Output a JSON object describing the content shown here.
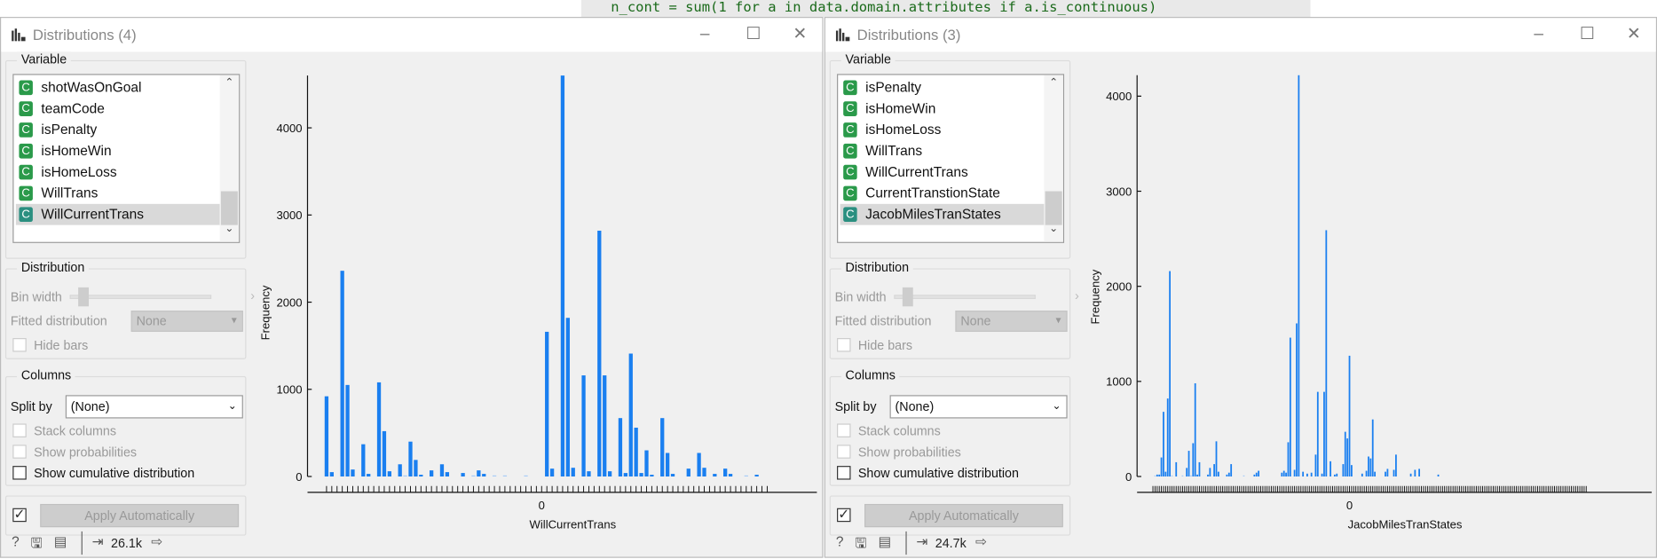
{
  "background_code": "n_cont = sum(1 for a in data.domain.attributes if a.is_continuous)",
  "windows": [
    {
      "title": "Distributions (4)",
      "variable_label": "Variable",
      "variables": [
        "shotWasOnGoal",
        "teamCode",
        "isPenalty",
        "isHomeWin",
        "isHomeLoss",
        "WillTrans",
        "WillCurrentTrans"
      ],
      "selected_index": 6,
      "var_type_badge": "C",
      "distribution_label": "Distribution",
      "bin_width_label": "Bin width",
      "fitted_label": "Fitted distribution",
      "fitted_value": "None",
      "hide_bars_label": "Hide bars",
      "columns_label": "Columns",
      "split_by_label": "Split by",
      "split_by_value": "(None)",
      "stack_label": "Stack columns",
      "prob_label": "Show probabilities",
      "cumulative_label": "Show cumulative distribution",
      "apply_label": "Apply Automatically",
      "apply_checked": true,
      "data_count": "26.1k"
    },
    {
      "title": "Distributions (3)",
      "variable_label": "Variable",
      "variables": [
        "isPenalty",
        "isHomeWin",
        "isHomeLoss",
        "WillTrans",
        "WillCurrentTrans",
        "CurrentTranstionState",
        "JacobMilesTranStates"
      ],
      "selected_index": 6,
      "var_type_badge": "C",
      "distribution_label": "Distribution",
      "bin_width_label": "Bin width",
      "fitted_label": "Fitted distribution",
      "fitted_value": "None",
      "hide_bars_label": "Hide bars",
      "columns_label": "Columns",
      "split_by_label": "Split by",
      "split_by_value": "(None)",
      "stack_label": "Stack columns",
      "prob_label": "Show probabilities",
      "cumulative_label": "Show cumulative distribution",
      "apply_label": "Apply Automatically",
      "apply_checked": true,
      "data_count": "24.7k"
    }
  ],
  "chart_data": [
    {
      "type": "bar",
      "title": "",
      "xlabel": "WillCurrentTrans",
      "ylabel": "Frequency",
      "ylim": [
        0,
        4600
      ],
      "yticks": [
        0,
        1000,
        2000,
        3000,
        4000
      ],
      "bin_count": 85,
      "xticks": [
        {
          "bin": 41,
          "label": "0"
        }
      ],
      "color": "#1a7ff0",
      "bins": [
        [
          0,
          920
        ],
        [
          1,
          50
        ],
        [
          3,
          2360
        ],
        [
          4,
          1050
        ],
        [
          5,
          80
        ],
        [
          7,
          370
        ],
        [
          8,
          30
        ],
        [
          10,
          1080
        ],
        [
          11,
          520
        ],
        [
          12,
          60
        ],
        [
          14,
          140
        ],
        [
          15,
          10
        ],
        [
          16,
          400
        ],
        [
          17,
          190
        ],
        [
          18,
          20
        ],
        [
          20,
          70
        ],
        [
          22,
          140
        ],
        [
          23,
          50
        ],
        [
          26,
          40
        ],
        [
          28,
          10
        ],
        [
          29,
          70
        ],
        [
          30,
          30
        ],
        [
          32,
          10
        ],
        [
          34,
          10
        ],
        [
          38,
          5
        ],
        [
          42,
          1660
        ],
        [
          43,
          90
        ],
        [
          45,
          4600
        ],
        [
          46,
          1820
        ],
        [
          47,
          100
        ],
        [
          49,
          1160
        ],
        [
          50,
          60
        ],
        [
          52,
          2820
        ],
        [
          53,
          1160
        ],
        [
          54,
          60
        ],
        [
          56,
          670
        ],
        [
          57,
          40
        ],
        [
          58,
          1410
        ],
        [
          59,
          560
        ],
        [
          60,
          40
        ],
        [
          61,
          300
        ],
        [
          62,
          20
        ],
        [
          64,
          670
        ],
        [
          65,
          270
        ],
        [
          66,
          30
        ],
        [
          69,
          90
        ],
        [
          71,
          270
        ],
        [
          72,
          100
        ],
        [
          74,
          30
        ],
        [
          76,
          90
        ],
        [
          77,
          30
        ],
        [
          80,
          10
        ],
        [
          82,
          20
        ]
      ]
    },
    {
      "type": "bar",
      "title": "",
      "xlabel": "JacobMilesTranStates",
      "ylabel": "Frequency",
      "ylim": [
        0,
        4220
      ],
      "yticks": [
        0,
        1000,
        2000,
        3000,
        4000
      ],
      "bin_count": 206,
      "xticks": [
        {
          "bin": 93,
          "label": "0"
        }
      ],
      "color": "#1a7ff0",
      "bins": [
        [
          1,
          10
        ],
        [
          2,
          20
        ],
        [
          3,
          20
        ],
        [
          4,
          200
        ],
        [
          5,
          680
        ],
        [
          6,
          50
        ],
        [
          7,
          820
        ],
        [
          8,
          2160
        ],
        [
          9,
          10
        ],
        [
          11,
          150
        ],
        [
          14,
          10
        ],
        [
          16,
          90
        ],
        [
          17,
          270
        ],
        [
          18,
          10
        ],
        [
          19,
          350
        ],
        [
          20,
          980
        ],
        [
          21,
          20
        ],
        [
          22,
          150
        ],
        [
          26,
          20
        ],
        [
          27,
          90
        ],
        [
          29,
          130
        ],
        [
          30,
          370
        ],
        [
          31,
          50
        ],
        [
          35,
          20
        ],
        [
          36,
          40
        ],
        [
          37,
          130
        ],
        [
          43,
          10
        ],
        [
          48,
          20
        ],
        [
          49,
          40
        ],
        [
          50,
          60
        ],
        [
          61,
          40
        ],
        [
          62,
          60
        ],
        [
          63,
          40
        ],
        [
          64,
          360
        ],
        [
          65,
          1460
        ],
        [
          67,
          70
        ],
        [
          68,
          1610
        ],
        [
          69,
          4220
        ],
        [
          71,
          50
        ],
        [
          73,
          30
        ],
        [
          75,
          40
        ],
        [
          77,
          230
        ],
        [
          78,
          890
        ],
        [
          80,
          30
        ],
        [
          81,
          890
        ],
        [
          82,
          2590
        ],
        [
          84,
          160
        ],
        [
          86,
          20
        ],
        [
          87,
          30
        ],
        [
          90,
          130
        ],
        [
          91,
          470
        ],
        [
          92,
          400
        ],
        [
          93,
          1270
        ],
        [
          94,
          120
        ],
        [
          99,
          30
        ],
        [
          101,
          60
        ],
        [
          102,
          210
        ],
        [
          103,
          190
        ],
        [
          104,
          600
        ],
        [
          105,
          50
        ],
        [
          110,
          50
        ],
        [
          111,
          80
        ],
        [
          114,
          70
        ],
        [
          115,
          230
        ],
        [
          122,
          30
        ],
        [
          124,
          70
        ],
        [
          126,
          80
        ],
        [
          135,
          20
        ]
      ]
    }
  ]
}
